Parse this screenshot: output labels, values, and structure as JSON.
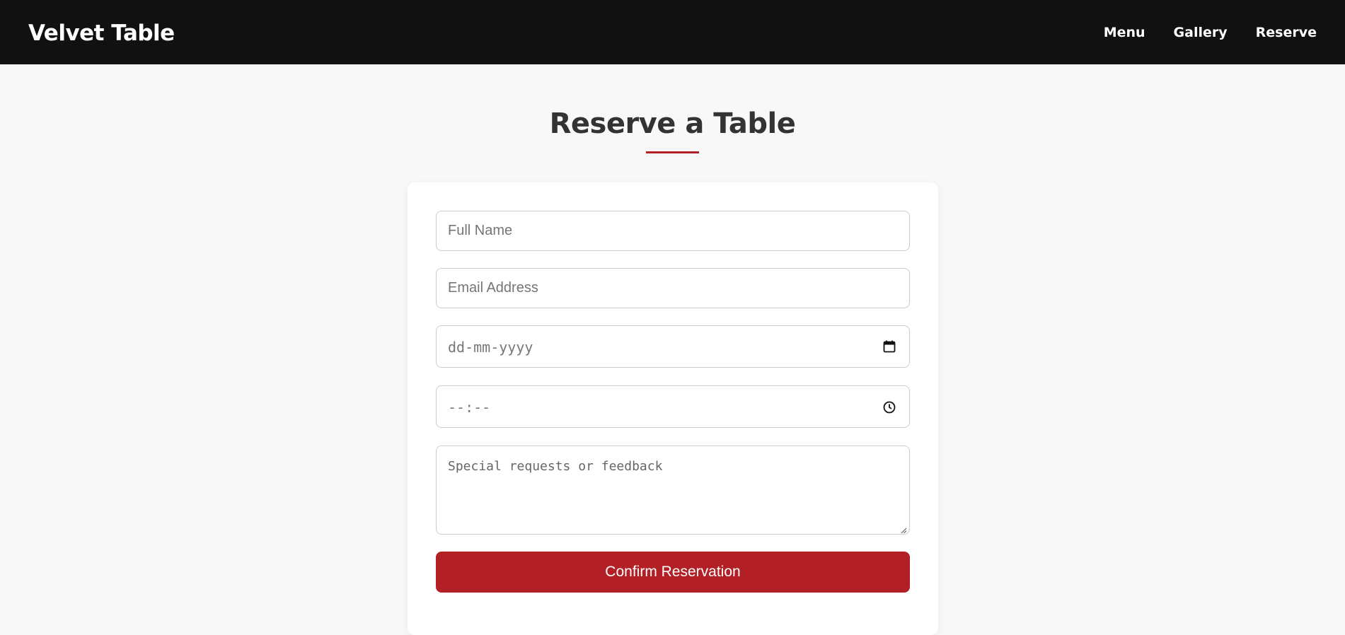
{
  "header": {
    "brand": "Velvet Table",
    "nav": [
      "Menu",
      "Gallery",
      "Reserve"
    ]
  },
  "main": {
    "title": "Reserve a Table",
    "form": {
      "name_placeholder": "Full Name",
      "email_placeholder": "Email Address",
      "date_value": "dd-mm-yyyy",
      "date_icon": "calendar-icon",
      "time_value": "--:--",
      "time_icon": "clock-icon",
      "notes_placeholder": "Special requests or feedback",
      "submit_label": "Confirm Reservation"
    }
  },
  "colors": {
    "header_bg": "#111111",
    "accent": "#b22025",
    "page_bg": "#f8f8f8"
  }
}
